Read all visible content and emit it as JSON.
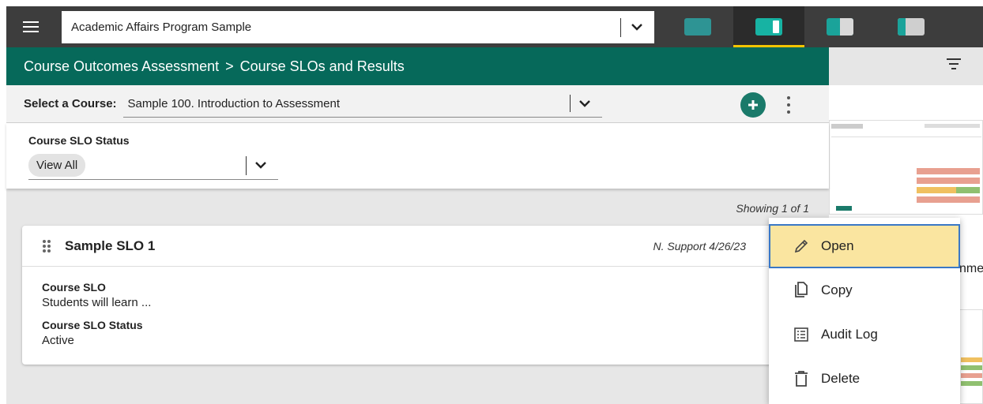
{
  "topbar": {
    "program": "Academic Affairs Program Sample",
    "tabs": [
      {
        "name": "tab-1",
        "color": "#2e9494",
        "active": false
      },
      {
        "name": "tab-2",
        "color": "#17b3a3",
        "active": true
      },
      {
        "name": "tab-3",
        "color": "#1aa39a",
        "active": false
      },
      {
        "name": "tab-4",
        "color": "#cfcfcf",
        "active": false
      }
    ]
  },
  "breadcrumb": {
    "section": "Course Outcomes Assessment",
    "separator": ">",
    "page": "Course SLOs and Results"
  },
  "course_select": {
    "label": "Select a Course:",
    "value": "Sample 100. Introduction to Assessment"
  },
  "filter": {
    "label": "Course SLO Status",
    "value": "View All"
  },
  "results": {
    "showing": "Showing 1 of 1"
  },
  "card": {
    "title": "Sample SLO 1",
    "meta": "N. Support 4/26/23",
    "fields": [
      {
        "label": "Course SLO",
        "value": "Students will learn ..."
      },
      {
        "label": "Course SLO Status",
        "value": "Active"
      }
    ]
  },
  "menu": {
    "items": [
      {
        "label": "Open",
        "icon": "pencil-icon"
      },
      {
        "label": "Copy",
        "icon": "copy-icon"
      },
      {
        "label": "Audit Log",
        "icon": "list-icon"
      },
      {
        "label": "Delete",
        "icon": "trash-icon"
      }
    ]
  },
  "background": {
    "partial_text": "nme"
  },
  "colors": {
    "header_green": "#06695a",
    "topbar": "#3d3d3d",
    "accent_yellow": "#f5c400",
    "highlight": "#fae5a0"
  }
}
